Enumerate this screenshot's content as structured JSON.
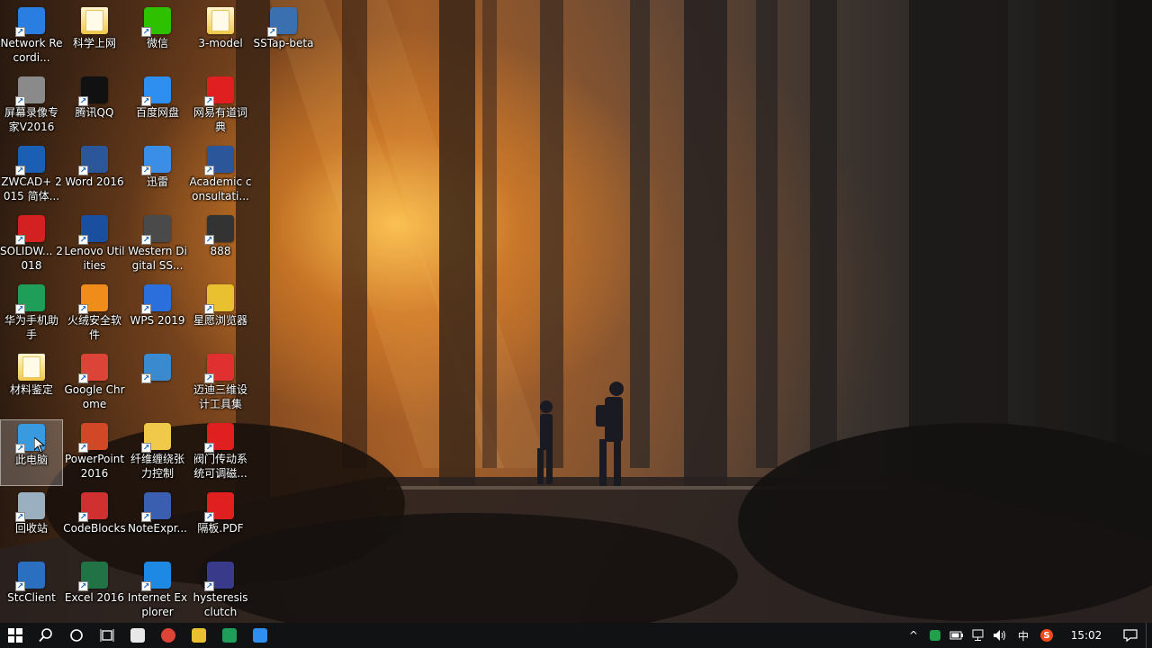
{
  "desktop": {
    "icons": [
      {
        "label": "Network Recordi...",
        "icon": "network-recorder-icon",
        "color": "#2a7de1"
      },
      {
        "label": "科学上网",
        "icon": "folder-icon",
        "color": "#f0c84a"
      },
      {
        "label": "微信",
        "icon": "wechat-icon",
        "color": "#2dc100"
      },
      {
        "label": "3-model",
        "icon": "folder-icon",
        "color": "#f0c84a"
      },
      {
        "label": "SSTap-beta",
        "icon": "sstap-icon",
        "color": "#3a6fb0"
      },
      {
        "label": "屏幕录像专家V2016",
        "icon": "screen-recorder-icon",
        "color": "#8a8a8a"
      },
      {
        "label": "腾讯QQ",
        "icon": "qq-penguin-icon",
        "color": "#111111"
      },
      {
        "label": "百度网盘",
        "icon": "baidu-netdisk-icon",
        "color": "#2e8ff0"
      },
      {
        "label": "网易有道词典",
        "icon": "youdao-dict-icon",
        "color": "#e02020"
      },
      {
        "label": "ZWCAD+ 2015 简体...",
        "icon": "zwcad-icon",
        "color": "#1a5fb4"
      },
      {
        "label": "Word 2016",
        "icon": "word-icon",
        "color": "#2b579a"
      },
      {
        "label": "迅雷",
        "icon": "xunlei-icon",
        "color": "#3a8ee6"
      },
      {
        "label": "Academic consultati...",
        "icon": "word-document-icon",
        "color": "#2b579a"
      },
      {
        "label": "SOLIDW... 2018",
        "icon": "solidworks-icon",
        "color": "#d32020"
      },
      {
        "label": "Lenovo Utilities",
        "icon": "lenovo-utilities-icon",
        "color": "#1a4fa0"
      },
      {
        "label": "Western Digital SS...",
        "icon": "wd-ssd-icon",
        "color": "#4a4a4a"
      },
      {
        "label": "888",
        "icon": "book-icon",
        "color": "#333333"
      },
      {
        "label": "华为手机助手",
        "icon": "huawei-hisuite-icon",
        "color": "#1f9e5a"
      },
      {
        "label": "火绒安全软件",
        "icon": "huorong-icon",
        "color": "#f08c1a"
      },
      {
        "label": "WPS 2019",
        "icon": "wps-icon",
        "color": "#2a6fdc"
      },
      {
        "label": "星愿浏览器",
        "icon": "twinkstar-browser-icon",
        "color": "#e8c030"
      },
      {
        "label": "材料鉴定",
        "icon": "folder-icon",
        "color": "#f0c84a"
      },
      {
        "label": "Google Chrome",
        "icon": "chrome-icon",
        "color": "#db4437"
      },
      {
        "label": "",
        "icon": "control-panel-icon",
        "color": "#3a8ad0"
      },
      {
        "label": "迈迪三维设计工具集",
        "icon": "maidi-tools-icon",
        "color": "#e03030"
      },
      {
        "label": "此电脑",
        "icon": "this-pc-icon",
        "color": "#3a9ae0"
      },
      {
        "label": "PowerPoint 2016",
        "icon": "powerpoint-icon",
        "color": "#d24726"
      },
      {
        "label": "纤维缠绕张力控制",
        "icon": "document-icon",
        "color": "#f0c84a"
      },
      {
        "label": "阀门传动系统可调磁...",
        "icon": "pdf-icon",
        "color": "#e02020"
      },
      {
        "label": "回收站",
        "icon": "recycle-bin-icon",
        "color": "#9ab0c0"
      },
      {
        "label": "CodeBlocks",
        "icon": "codeblocks-icon",
        "color": "#d03030"
      },
      {
        "label": "NoteExpr...",
        "icon": "noteexpress-icon",
        "color": "#3a5fb0"
      },
      {
        "label": "隔板.PDF",
        "icon": "pdf-icon",
        "color": "#e02020"
      },
      {
        "label": "StcClient",
        "icon": "stcclient-icon",
        "color": "#2a6fc0"
      },
      {
        "label": "Excel 2016",
        "icon": "excel-icon",
        "color": "#217346"
      },
      {
        "label": "Internet Explorer",
        "icon": "ie-icon",
        "color": "#1e88e5"
      },
      {
        "label": "hysteresis clutch",
        "icon": "pdf-document-icon",
        "color": "#3a3a8a"
      }
    ]
  },
  "taskbar": {
    "start_icon": "windows-start-icon",
    "search_icon": "search-icon",
    "cortana_icon": "cortana-circle-icon",
    "task_view_icon": "task-view-icon",
    "pinned": [
      {
        "name": "calculator-icon",
        "color": "#e8e8e8"
      },
      {
        "name": "chrome-icon",
        "color": "#db4437"
      },
      {
        "name": "twinkstar-browser-icon",
        "color": "#e8c030"
      },
      {
        "name": "green-app-icon",
        "color": "#1f9e5a"
      },
      {
        "name": "baidu-netdisk-icon",
        "color": "#2e8ff0"
      }
    ],
    "tray": {
      "chevron": "^",
      "ime": "中",
      "time": "15:02"
    }
  }
}
